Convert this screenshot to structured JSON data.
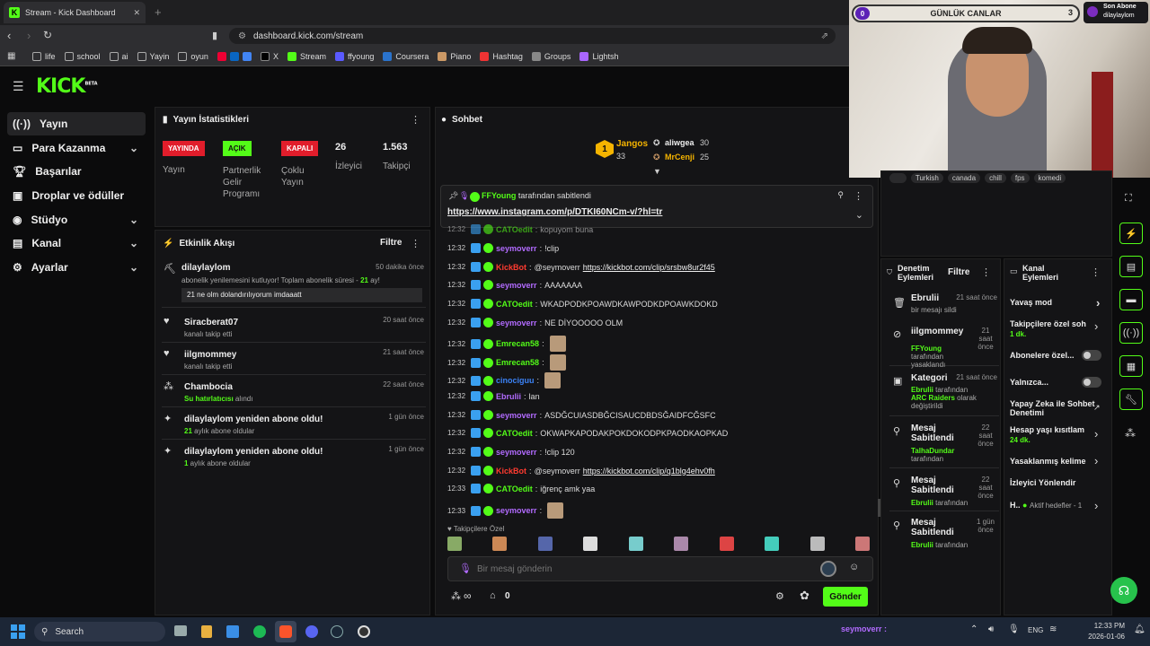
{
  "browser": {
    "tab_title": "Stream - Kick Dashboard",
    "url": "dashboard.kick.com/stream",
    "bookmarks": [
      "life",
      "school",
      "ai",
      "Yayin",
      "oyun",
      "X",
      "Stream",
      "ffyoung",
      "Coursera",
      "Piano",
      "Hashtag",
      "Groups",
      "Lightsh"
    ]
  },
  "brand": {
    "logo": "KICK",
    "beta": "BETA",
    "accent": "#53fc18"
  },
  "sidebar": {
    "items": [
      {
        "label": "Yayın",
        "icon": "broadcast-icon"
      },
      {
        "label": "Para Kazanma",
        "icon": "money-icon"
      },
      {
        "label": "Başarılar",
        "icon": "trophy-icon"
      },
      {
        "label": "Droplar ve ödüller",
        "icon": "gift-icon"
      },
      {
        "label": "Stüdyo",
        "icon": "studio-icon"
      },
      {
        "label": "Kanal",
        "icon": "channel-icon"
      },
      {
        "label": "Ayarlar",
        "icon": "gear-icon"
      }
    ]
  },
  "stats": {
    "title": "Yayın İstatistikleri",
    "badges": [
      {
        "badge": "YAYINDA",
        "label": "Yayın"
      },
      {
        "badge": "AÇIK",
        "label": "Partnerlik Gelir Programı"
      },
      {
        "badge": "KAPALI",
        "label": "Çoklu Yayın"
      }
    ],
    "viewers": {
      "value": "26",
      "label": "İzleyici"
    },
    "followers": {
      "value": "1.563",
      "label": "Takipçi"
    }
  },
  "activity": {
    "title": "Etkinlik Akışı",
    "filter": "Filtre",
    "items": [
      {
        "name": "dilaylaylom",
        "time": "50 dakika önce",
        "sub_pre": "abonelik yenilemesini kutluyor! Toplam abonelik süresi - ",
        "sub_hl": "21",
        "sub_post": " ay!",
        "message": "21 ne olm dolandırılıyorum imdaaatt"
      },
      {
        "name": "Siracberat07",
        "time": "20 saat önce",
        "sub": "kanalı takip etti"
      },
      {
        "name": "iilgmommey",
        "time": "21 saat önce",
        "sub": "kanalı takip etti"
      },
      {
        "name": "Chambocia",
        "time": "22 saat önce",
        "sub_hl": "Su hatırlatıcısı",
        "sub_post": " alındı"
      },
      {
        "name": "dilaylaylom yeniden abone oldu!",
        "time": "1 gün önce",
        "sub_hl": "21",
        "sub_post": " aylık abone oldular"
      },
      {
        "name": "dilaylaylom yeniden abone oldu!",
        "time": "1 gün önce",
        "sub_hl": "1",
        "sub_post": " aylık abone oldular"
      }
    ]
  },
  "chat": {
    "title": "Sohbet",
    "leaderboard": [
      {
        "rank": "1",
        "name": "Jangos",
        "count": "33"
      },
      {
        "name": "aliwgea",
        "count": "30"
      },
      {
        "name": "MrCenji",
        "count": "25"
      }
    ],
    "pinned": {
      "by": "FFYoung",
      "text": "tarafından sabitlendi",
      "link": "https://www.instagram.com/p/DTKI60NCm-v/?hl=tr"
    },
    "messages": [
      {
        "time": "12:32",
        "user": "CATOedit",
        "color": "#53fc18",
        "text": "kopuyom buna"
      },
      {
        "time": "12:32",
        "user": "seymoverr",
        "color": "#b26bff",
        "text": "!clip"
      },
      {
        "time": "12:32",
        "user": "KickBot",
        "color": "#ff3b30",
        "text": "@seymoverr ",
        "link": "https://kickbot.com/clip/srsbw8ur2f45"
      },
      {
        "time": "12:32",
        "user": "seymoverr",
        "color": "#b26bff",
        "text": "AAAAAAA"
      },
      {
        "time": "12:32",
        "user": "CATOedit",
        "color": "#53fc18",
        "text": "WKADPODKPOAWDKAWPODKDPOAWKDOKD"
      },
      {
        "time": "12:32",
        "user": "seymoverr",
        "color": "#b26bff",
        "text": "NE DİYOOOOO OLM"
      },
      {
        "time": "12:32",
        "user": "Emrecan58",
        "color": "#53fc18",
        "text": ""
      },
      {
        "time": "12:32",
        "user": "Emrecan58",
        "color": "#53fc18",
        "text": ""
      },
      {
        "time": "12:32",
        "user": "cinociguu",
        "color": "#3b82f6",
        "text": ""
      },
      {
        "time": "12:32",
        "user": "Ebrulii",
        "color": "#b26bff",
        "text": "lan"
      },
      {
        "time": "12:32",
        "user": "seymoverr",
        "color": "#b26bff",
        "text": "ASDĞCUIASDBĞCISAUCDBDSĞAIDFCĞSFC"
      },
      {
        "time": "12:32",
        "user": "CATOedit",
        "color": "#53fc18",
        "text": "OKWAPKAPODAKPOKDOKODPKPAODKAOPKAD"
      },
      {
        "time": "12:32",
        "user": "seymoverr",
        "color": "#b26bff",
        "text": "!clip 120"
      },
      {
        "time": "12:32",
        "user": "KickBot",
        "color": "#ff3b30",
        "text": "@seymoverr ",
        "link": "https://kickbot.com/clip/q1blg4ehv0fh"
      },
      {
        "time": "12:33",
        "user": "CATOedit",
        "color": "#53fc18",
        "text": "iğrenç amk yaa"
      },
      {
        "time": "12:33",
        "user": "seymoverr",
        "color": "#b26bff",
        "text": ""
      }
    ],
    "followers_only": "Takipçilere Özel",
    "input_placeholder": "Bir mesaj gönderin",
    "points": "∞",
    "shop_count": "0",
    "send": "Gönder"
  },
  "overlay": {
    "goal_left": "0",
    "goal_label": "GÜNLÜK CANLAR",
    "goal_right": "3",
    "last_sub_label": "Son Abone",
    "last_sub_name": "dilaylaylom",
    "tags": [
      "Turkish",
      "canada",
      "chill",
      "fps",
      "komedi"
    ]
  },
  "mod": {
    "title": "Denetim Eylemleri",
    "filter": "Filtre",
    "items": [
      {
        "name": "Ebrulii",
        "time": "21 saat önce",
        "sub": "bir mesajı sildi"
      },
      {
        "name": "iilgmommey",
        "time": "21 saat önce",
        "hl": "FFYoung",
        "sub": " tarafından yasaklandı"
      },
      {
        "name": "Kategori",
        "time": "21 saat önce",
        "hl": "Ebrulii",
        "sub": " tarafından ",
        "hl2": "ARC Raiders",
        "sub2": " olarak değiştirildi"
      },
      {
        "name": "Mesaj Sabitlendi",
        "time": "22 saat önce",
        "hl": "TalhaDundar",
        "sub": " tarafından"
      },
      {
        "name": "Mesaj Sabitlendi",
        "time": "22 saat önce",
        "hl": "Ebrulii",
        "sub": " tarafından"
      },
      {
        "name": "Mesaj Sabitlendi",
        "time": "1 gün önce",
        "hl": "Ebrulii",
        "sub": " tarafından"
      }
    ]
  },
  "channel_actions": {
    "title": "Kanal Eylemleri",
    "items": [
      {
        "label": "Yavaş mod"
      },
      {
        "label": "Takipçilere özel soh",
        "sub": "1 dk."
      },
      {
        "label": "Abonelere özel..."
      },
      {
        "label": "Yalnızca..."
      },
      {
        "label": "Yapay Zeka ile Sohbet Denetimi"
      },
      {
        "label": "Hesap yaşı kısıtlam",
        "sub": "24 dk."
      },
      {
        "label": "Yasaklanmış kelime"
      },
      {
        "label": "İzleyici Yönlendir"
      },
      {
        "label": "H..",
        "sub": "Aktif hedefler - 1"
      }
    ]
  },
  "taskbar": {
    "search": "Search",
    "chat_user": "seymoverr :",
    "lang": "ENG",
    "time": "12:33 PM",
    "date": "2026-01-06"
  }
}
